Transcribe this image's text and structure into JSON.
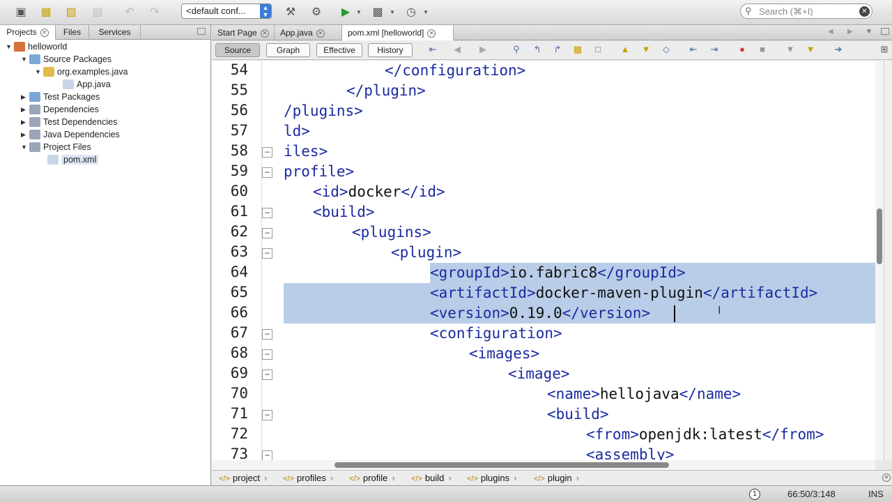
{
  "toolbar": {
    "config_label": "<default conf...",
    "search_placeholder": "Search (⌘+I)"
  },
  "left_panel": {
    "tabs": [
      "Projects",
      "Files",
      "Services"
    ],
    "tree": [
      {
        "label": "helloworld"
      },
      {
        "label": "Source Packages"
      },
      {
        "label": "org.examples.java"
      },
      {
        "label": "App.java"
      },
      {
        "label": "Test Packages"
      },
      {
        "label": "Dependencies"
      },
      {
        "label": "Test Dependencies"
      },
      {
        "label": "Java Dependencies"
      },
      {
        "label": "Project Files"
      },
      {
        "label": "pom.xml"
      }
    ]
  },
  "editor_tabs": [
    "Start Page",
    "App.java",
    "pom.xml [helloworld]"
  ],
  "view_buttons": [
    "Source",
    "Graph",
    "Effective",
    "History"
  ],
  "code": {
    "line_numbers": [
      "54",
      "55",
      "56",
      "57",
      "58",
      "59",
      "60",
      "61",
      "62",
      "63",
      "64",
      "65",
      "66",
      "67",
      "68",
      "69",
      "70",
      "71",
      "72",
      "73"
    ],
    "lines": [
      [
        [
          "t",
          "</configuration>"
        ]
      ],
      [
        [
          "t",
          "</plugin>"
        ]
      ],
      [
        [
          "t",
          "/plugins>"
        ]
      ],
      [
        [
          "t",
          "ld>"
        ]
      ],
      [
        [
          "t",
          "iles>"
        ]
      ],
      [
        [
          "t",
          "profile>"
        ]
      ],
      [
        [
          "t",
          "<id>"
        ],
        [
          "x",
          "docker"
        ],
        [
          "t",
          "</id>"
        ]
      ],
      [
        [
          "t",
          "<build>"
        ]
      ],
      [
        [
          "t",
          "<plugins>"
        ]
      ],
      [
        [
          "t",
          "<plugin>"
        ]
      ],
      [
        [
          "t",
          "<groupId>"
        ],
        [
          "x",
          "io.fabric8"
        ],
        [
          "t",
          "</groupId>"
        ]
      ],
      [
        [
          "t",
          "<artifactId>"
        ],
        [
          "x",
          "docker-maven-plugin"
        ],
        [
          "t",
          "</artifactId>"
        ]
      ],
      [
        [
          "t",
          "<version>"
        ],
        [
          "x",
          "0.19.0"
        ],
        [
          "t",
          "</version>"
        ]
      ],
      [
        [
          "t",
          "<configuration>"
        ]
      ],
      [
        [
          "t",
          "<images>"
        ]
      ],
      [
        [
          "t",
          "<image>"
        ]
      ],
      [
        [
          "t",
          "<name>"
        ],
        [
          "x",
          "hellojava"
        ],
        [
          "t",
          "</name>"
        ]
      ],
      [
        [
          "t",
          "<build>"
        ]
      ],
      [
        [
          "t",
          "<from>"
        ],
        [
          "x",
          "openjdk:latest"
        ],
        [
          "t",
          "</from>"
        ]
      ],
      [
        [
          "t",
          "<assembly>"
        ]
      ]
    ]
  },
  "breadcrumb": [
    "project",
    "profiles",
    "profile",
    "build",
    "plugins",
    "plugin"
  ],
  "status": {
    "notifications": "1",
    "position": "66:50/3:148",
    "mode": "INS"
  },
  "colors": {
    "tag": "#1a2aa0",
    "selection": "#b9cde8"
  }
}
